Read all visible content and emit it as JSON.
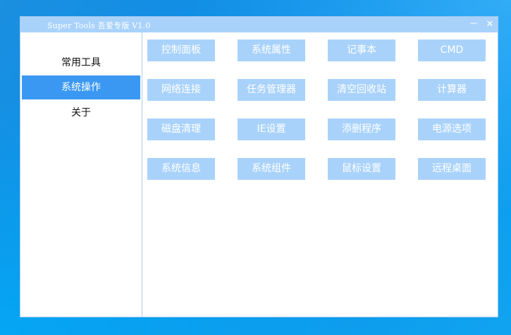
{
  "window": {
    "title": "Super Tools 吾爱专版 V1.0",
    "minimize_label": "－",
    "close_label": "✕"
  },
  "sidebar": {
    "items": [
      {
        "label": "常用工具",
        "selected": false
      },
      {
        "label": "系统操作",
        "selected": true
      },
      {
        "label": "关于",
        "selected": false
      }
    ]
  },
  "tools": {
    "buttons": [
      {
        "label": "控制面板"
      },
      {
        "label": "系统属性"
      },
      {
        "label": "记事本"
      },
      {
        "label": "CMD"
      },
      {
        "label": "网络连接"
      },
      {
        "label": "任务管理器"
      },
      {
        "label": "清空回收站"
      },
      {
        "label": "计算器"
      },
      {
        "label": "磁盘清理"
      },
      {
        "label": "IE设置"
      },
      {
        "label": "添删程序"
      },
      {
        "label": "电源选项"
      },
      {
        "label": "系统信息"
      },
      {
        "label": "系统组件"
      },
      {
        "label": "鼠标设置"
      },
      {
        "label": "远程桌面"
      }
    ]
  },
  "colors": {
    "titlebar": "#a9d2fb",
    "button_bg": "#a9d2fb",
    "nav_selected": "#3a98f2",
    "desktop": "#0a8ee8"
  }
}
